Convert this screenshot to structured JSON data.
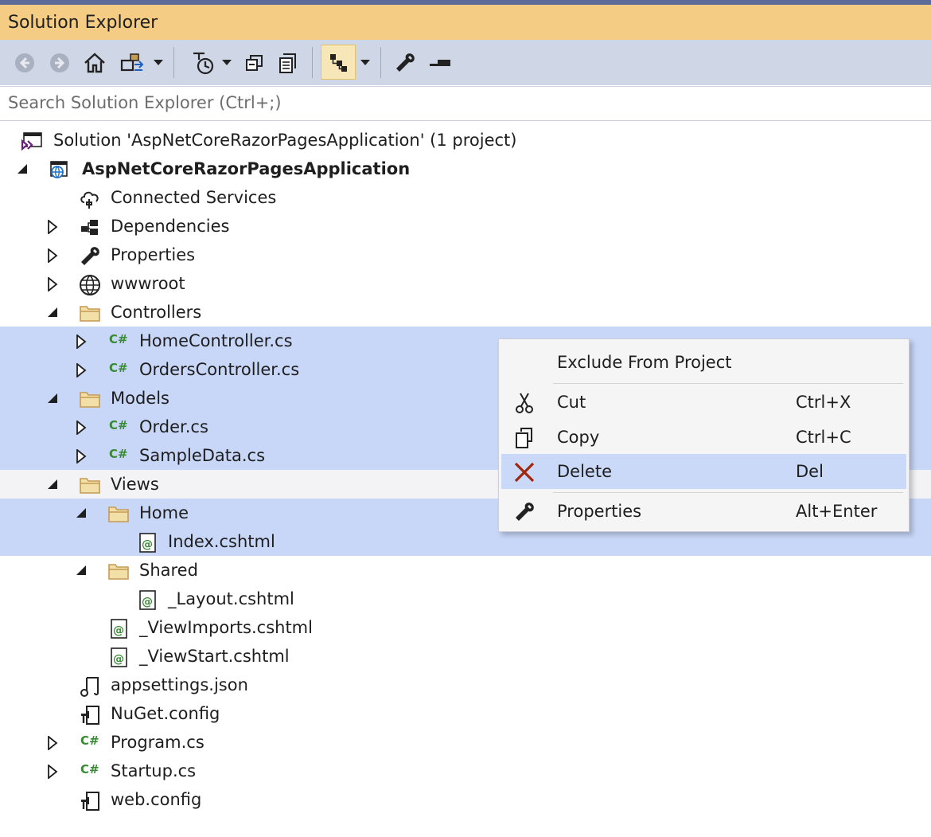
{
  "window": {
    "title": "Solution Explorer"
  },
  "toolbar": {
    "buttons": [
      "back-icon",
      "forward-icon",
      "home-icon",
      "switch-views-icon",
      "dropdown-icon",
      "pending-changes-filter-icon",
      "dropdown-icon",
      "collapse-all-icon",
      "show-all-files-icon",
      "sync-with-active-document-icon",
      "dropdown-icon",
      "properties-wrench-icon",
      "preview-selected-items-icon"
    ]
  },
  "search": {
    "placeholder": "Search Solution Explorer (Ctrl+;)"
  },
  "tree": {
    "rows": [
      {
        "label": "Solution 'AspNetCoreRazorPagesApplication' (1 project)",
        "icon": "visual-studio-solution-icon"
      },
      {
        "label": "AspNetCoreRazorPagesApplication",
        "icon": "web-project-icon",
        "expanded": true
      },
      {
        "label": "Connected Services",
        "icon": "connected-services-icon"
      },
      {
        "label": "Dependencies",
        "icon": "dependencies-icon",
        "expanded": false
      },
      {
        "label": "Properties",
        "icon": "wrench-icon",
        "expanded": false
      },
      {
        "label": "wwwroot",
        "icon": "globe-icon",
        "expanded": false
      },
      {
        "label": "Controllers",
        "icon": "folder-icon",
        "expanded": true
      },
      {
        "label": "HomeController.cs",
        "icon": "csharp-file-icon",
        "expanded": false,
        "selected": true
      },
      {
        "label": "OrdersController.cs",
        "icon": "csharp-file-icon",
        "expanded": false,
        "selected": true
      },
      {
        "label": "Models",
        "icon": "folder-icon",
        "expanded": true,
        "selected": true
      },
      {
        "label": "Order.cs",
        "icon": "csharp-file-icon",
        "expanded": false,
        "selected": true
      },
      {
        "label": "SampleData.cs",
        "icon": "csharp-file-icon",
        "expanded": false,
        "selected": true
      },
      {
        "label": "Views",
        "icon": "folder-icon",
        "expanded": true
      },
      {
        "label": "Home",
        "icon": "folder-icon",
        "expanded": true,
        "selected": true
      },
      {
        "label": "Index.cshtml",
        "icon": "razor-file-icon",
        "selected": true
      },
      {
        "label": "Shared",
        "icon": "folder-icon",
        "expanded": true
      },
      {
        "label": "_Layout.cshtml",
        "icon": "razor-file-icon"
      },
      {
        "label": "_ViewImports.cshtml",
        "icon": "razor-file-icon"
      },
      {
        "label": "_ViewStart.cshtml",
        "icon": "razor-file-icon"
      },
      {
        "label": "appsettings.json",
        "icon": "json-file-icon"
      },
      {
        "label": "NuGet.config",
        "icon": "config-file-icon"
      },
      {
        "label": "Program.cs",
        "icon": "csharp-file-icon",
        "expanded": false
      },
      {
        "label": "Startup.cs",
        "icon": "csharp-file-icon",
        "expanded": false
      },
      {
        "label": "web.config",
        "icon": "config-file-icon"
      }
    ]
  },
  "context_menu": {
    "items": [
      {
        "label": "Exclude From Project",
        "shortcut": "",
        "icon": ""
      },
      {
        "label": "Cut",
        "shortcut": "Ctrl+X",
        "icon": "scissors-icon"
      },
      {
        "label": "Copy",
        "shortcut": "Ctrl+C",
        "icon": "copy-icon"
      },
      {
        "label": "Delete",
        "shortcut": "Del",
        "icon": "delete-x-icon",
        "highlighted": true
      },
      {
        "label": "Properties",
        "shortcut": "Alt+Enter",
        "icon": "wrench-icon"
      }
    ]
  },
  "colors": {
    "title_bar": "#f5cc84",
    "toolbar": "#cfd6e5",
    "selection": "#c8d7f8",
    "csharp_green": "#388a34",
    "folder": "#dcb67a",
    "delete_red": "#a1260d",
    "vs_purple": "#68217a"
  }
}
